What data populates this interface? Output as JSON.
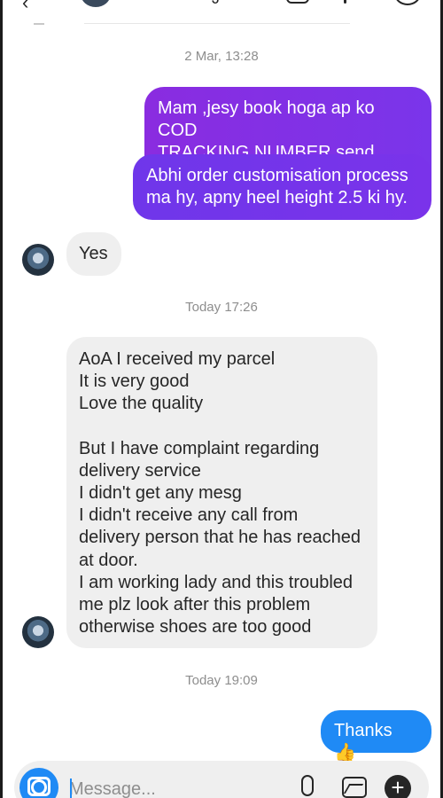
{
  "header": {
    "back_icon": "arrow-left-icon",
    "name_tail": "J",
    "call_icon": "phone-icon",
    "video_icon": "video-icon",
    "info_icon": "info-icon"
  },
  "messages": {
    "ts1": "2 Mar, 13:28",
    "sent1_line1": "Mam ,jesy book hoga ap ko COD",
    "sent1_line2": "TRACKING NUMBER send hoga.",
    "sent2_line1": "Abhi order customisation process",
    "sent2_line2": "ma hy, apny heel height 2.5 ki hy.",
    "recv1": "Yes",
    "ts2": "Today 17:26",
    "recv2_lines": [
      "AoA I received my parcel",
      "It is very good",
      "Love the quality",
      "",
      "But I have complaint regarding",
      "delivery service",
      "I didn't get any mesg",
      "I didn't receive any call from",
      "delivery person that he has reached",
      "at door.",
      "I am working lady and this troubled",
      "me plz look after this problem",
      "otherwise shoes are too good"
    ],
    "ts3": "Today 19:09",
    "sent3": "Thanks 👍"
  },
  "composer": {
    "placeholder": "Message...",
    "camera_icon": "camera-icon",
    "mic_icon": "microphone-icon",
    "gallery_icon": "gallery-icon",
    "plus_icon": "plus-icon"
  },
  "colors": {
    "sent_bubble": "#7b2ee6",
    "received_bubble": "#efefef",
    "thanks_bubble": "#1f8af5"
  }
}
